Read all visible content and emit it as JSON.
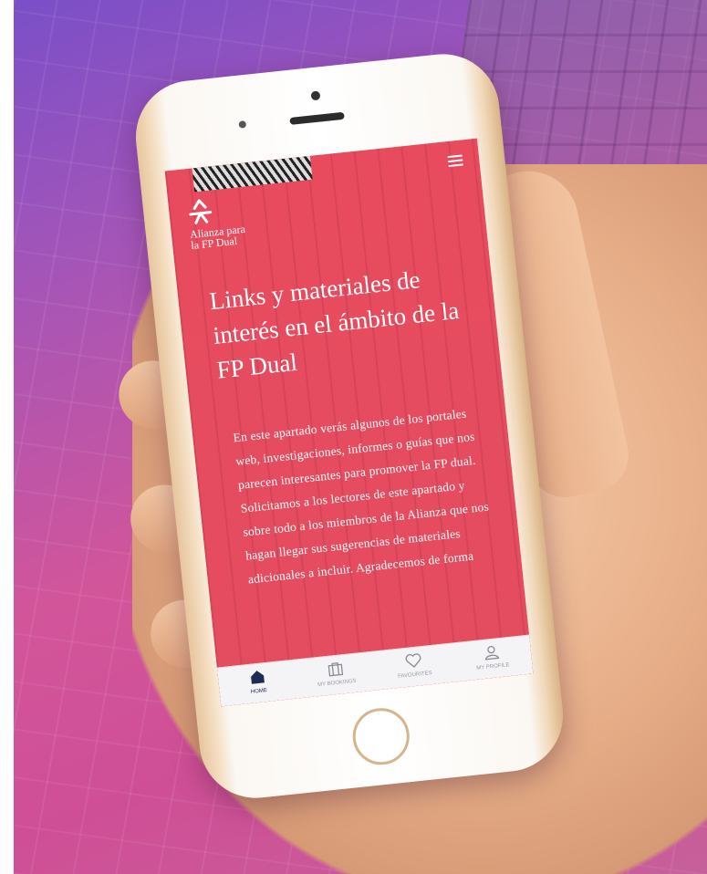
{
  "app": {
    "logo_text": "Alianza para\nla FP Dual",
    "headline": "Links y materiales de interés en el ámbito de la FP Dual",
    "body": "En este apartado verás algunos de los portales web, investigaciones, informes o guías que nos parecen interesantes para promover la FP dual. Solicitamos a los lectores de este apartado y sobre todo a los miembros de la Alianza que nos hagan llegar sus sugerencias de materiales adicionales a incluir. Agradecemos de forma"
  },
  "tabbar": {
    "items": [
      {
        "label": "HOME",
        "icon": "home-icon",
        "active": true
      },
      {
        "label": "MY BOOKINGS",
        "icon": "bookings-icon",
        "active": false
      },
      {
        "label": "FAVOURITES",
        "icon": "heart-icon",
        "active": false
      },
      {
        "label": "MY PROFILE",
        "icon": "profile-icon",
        "active": false
      }
    ]
  },
  "colors": {
    "accent": "#e74e5e",
    "active_tab": "#1e2b55",
    "background": "#cf4f96"
  }
}
